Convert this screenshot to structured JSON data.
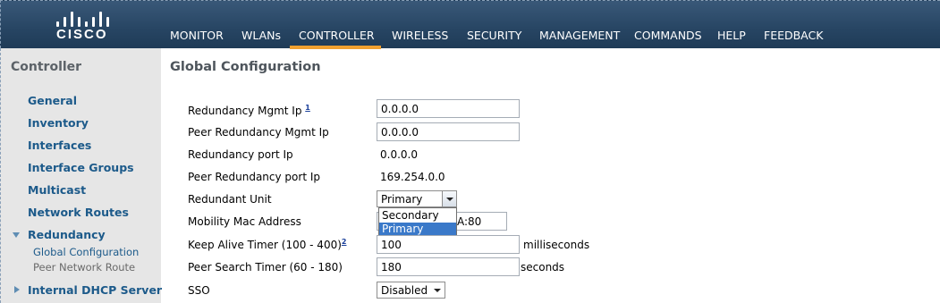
{
  "brand": {
    "name": "CISCO"
  },
  "nav": {
    "items": [
      {
        "label": "MONITOR"
      },
      {
        "label": "WLANs"
      },
      {
        "label": "CONTROLLER"
      },
      {
        "label": "WIRELESS"
      },
      {
        "label": "SECURITY"
      },
      {
        "label": "MANAGEMENT"
      },
      {
        "label": "COMMANDS"
      },
      {
        "label": "HELP"
      },
      {
        "label": "FEEDBACK"
      }
    ],
    "active": "CONTROLLER",
    "accent_color": "#f0a030"
  },
  "sidebar": {
    "title": "Controller",
    "items": [
      {
        "label": "General"
      },
      {
        "label": "Inventory"
      },
      {
        "label": "Interfaces"
      },
      {
        "label": "Interface Groups"
      },
      {
        "label": "Multicast"
      },
      {
        "label": "Network Routes"
      },
      {
        "label": "Redundancy"
      },
      {
        "label": "Internal DHCP Server"
      }
    ],
    "sub_items": [
      {
        "label": "Global Configuration"
      },
      {
        "label": "Peer Network Route"
      }
    ]
  },
  "main": {
    "title": "Global Configuration",
    "fields": {
      "redundancy_mgmt_ip": {
        "label": "Redundancy Mgmt Ip",
        "footnote": "1",
        "value": "0.0.0.0"
      },
      "peer_redundancy_mgmt_ip": {
        "label": "Peer Redundancy Mgmt Ip",
        "value": "0.0.0.0"
      },
      "redundancy_port_ip": {
        "label": "Redundancy port Ip",
        "value": "0.0.0.0"
      },
      "peer_redundancy_port_ip": {
        "label": "Peer Redundancy port Ip",
        "value": "169.254.0.0"
      },
      "redundant_unit": {
        "label": "Redundant Unit",
        "value": "Primary",
        "options": [
          "Secondary",
          "Primary"
        ]
      },
      "mobility_mac": {
        "label": "Mobility Mac Address",
        "value_visible": "A:80"
      },
      "keep_alive": {
        "label": "Keep Alive Timer (100 - 400)",
        "footnote": "2",
        "value": "100",
        "unit": "milliseconds"
      },
      "peer_search": {
        "label": "Peer Search Timer (60 - 180)",
        "value": "180",
        "unit": "seconds"
      },
      "sso": {
        "label": "SSO",
        "value": "Disabled"
      }
    }
  }
}
